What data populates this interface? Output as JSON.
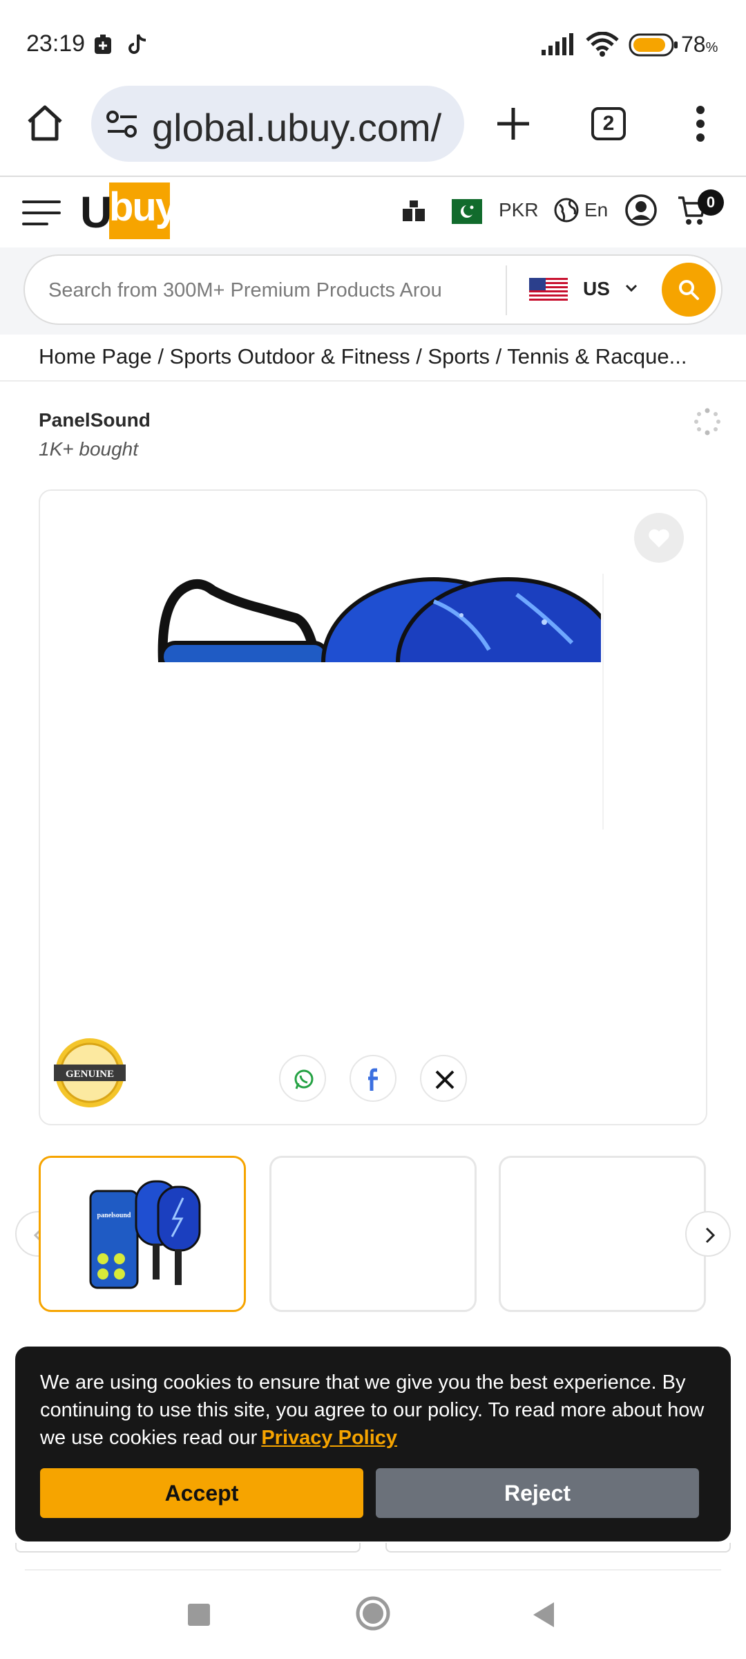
{
  "status_bar": {
    "time": "23:19",
    "battery": "78",
    "battery_unit": "%",
    "icons": [
      "battery-saver-icon",
      "tiktok-icon",
      "signal-icon",
      "wifi-icon",
      "battery-icon"
    ]
  },
  "browser": {
    "url": "global.ubuy.com/",
    "tab_count": "2"
  },
  "header": {
    "logo_first": "U",
    "logo_rest": "buy",
    "currency": "PKR",
    "language": "En",
    "cart_count": "0"
  },
  "search": {
    "placeholder": "Search from 300M+ Premium Products Arou",
    "country": "US"
  },
  "breadcrumb": "Home Page / Sports Outdoor & Fitness / Sports / Tennis & Racque...",
  "product": {
    "brand": "PanelSound",
    "bought": "1K+ bought",
    "badge_text": "GENUINE",
    "thumb_brand": "panelsound"
  },
  "cookie": {
    "text": "We are using cookies to ensure that we give you the best experience. By continuing to use this site, you agree to our policy. To read more about how we use cookies read our",
    "link": "Privacy Policy",
    "accept": "Accept",
    "reject": "Reject"
  },
  "colors": {
    "accent": "#f6a400",
    "banner_bg": "#171717",
    "reject_bg": "#6b717a"
  }
}
